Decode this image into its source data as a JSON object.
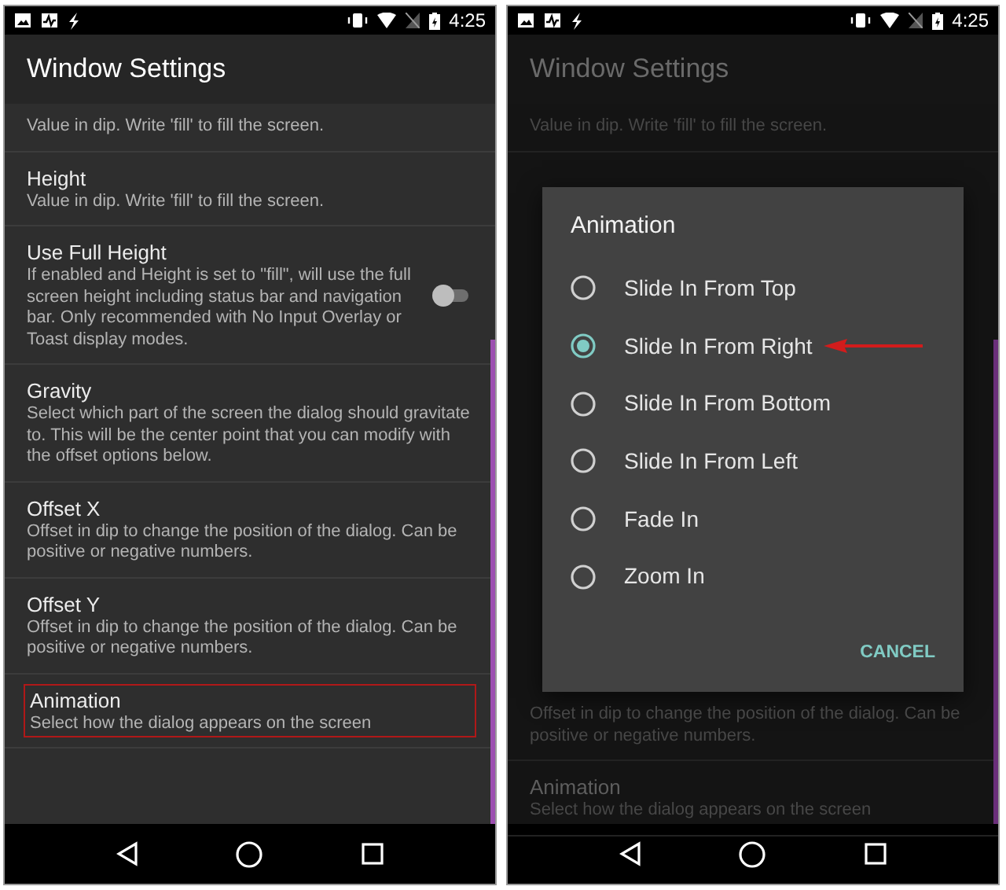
{
  "screens": [
    {
      "dimmed": false,
      "status_bar": {
        "time": "4:25"
      },
      "app_bar": {
        "title": "Window Settings"
      },
      "settings": [
        {
          "description": "Value in dip. Write 'fill' to fill the screen.",
          "highlighted": false
        },
        {
          "title": "Height",
          "description": "Value in dip. Write 'fill' to fill the screen.",
          "highlighted": false
        },
        {
          "title": "Use Full Height",
          "description": "If enabled and Height is set to \"fill\", will use the full screen height including status bar and navigation bar. Only recommended with No Input Overlay or Toast display modes.",
          "highlighted": false,
          "switch": {
            "on": false
          }
        },
        {
          "title": "Gravity",
          "description": "Select which part of the screen the dialog should gravitate to. This will be the center point that you can modify with the offset options below.",
          "highlighted": false
        },
        {
          "title": "Offset X",
          "description": "Offset in dip to change the position of the dialog. Can be positive or negative numbers.",
          "highlighted": false
        },
        {
          "title": "Offset Y",
          "description": "Offset in dip to change the position of the dialog. Can be positive or negative numbers.",
          "highlighted": false
        },
        {
          "title": "Animation",
          "description": "Select how the dialog appears on the screen",
          "highlighted": true
        }
      ]
    },
    {
      "dimmed": true,
      "status_bar": {
        "time": "4:25"
      },
      "app_bar": {
        "title": "Window Settings"
      },
      "settings": [
        {
          "description": "Value in dip. Write 'fill' to fill the screen.",
          "highlighted": false
        }
      ],
      "dialog": {
        "title": "Animation",
        "options": [
          {
            "label": "Slide In From Top",
            "selected": false,
            "pointed_at": false
          },
          {
            "label": "Slide In From Right",
            "selected": true,
            "pointed_at": true
          },
          {
            "label": "Slide In From Bottom",
            "selected": false,
            "pointed_at": false
          },
          {
            "label": "Slide In From Left",
            "selected": false,
            "pointed_at": false
          },
          {
            "label": "Fade In",
            "selected": false,
            "pointed_at": false
          },
          {
            "label": "Zoom In",
            "selected": false,
            "pointed_at": false
          }
        ],
        "buttons": [
          "CANCEL"
        ]
      },
      "settings_below": [
        {
          "description": "Offset in dip to change the position of the dialog. Can be positive or negative numbers.",
          "highlighted": false
        },
        {
          "title": "Animation",
          "description": "Select how the dialog appears on the screen",
          "highlighted": false
        }
      ]
    }
  ]
}
